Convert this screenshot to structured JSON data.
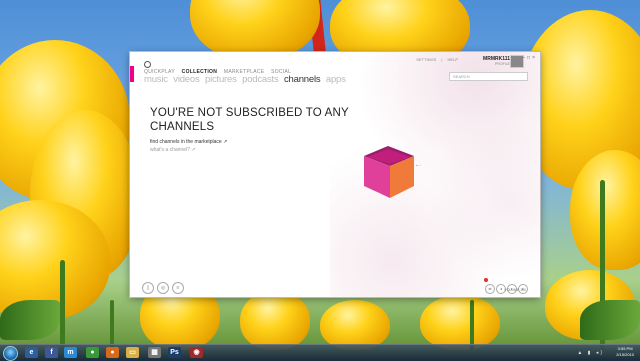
{
  "window": {
    "nav_primary": [
      "QUICKPLAY",
      "COLLECTION",
      "MARKETPLACE",
      "SOCIAL"
    ],
    "nav_primary_active": "COLLECTION",
    "nav_secondary": [
      "music",
      "videos",
      "pictures",
      "podcasts",
      "channels",
      "apps"
    ],
    "nav_secondary_active": "channels",
    "top_links": [
      "SETTINGS",
      "HELP"
    ],
    "user_name": "MRMRK111",
    "user_sub": "PROFILE",
    "search_placeholder": "SEARCH",
    "headline": "YOU'RE NOT SUBSCRIBED TO ANY CHANNELS",
    "link_find": "find channels in the marketplace",
    "link_what": "what's a channel?",
    "volume_label": "VOLUME 100"
  },
  "colors": {
    "accent": "#ec008c",
    "cube_top": "#d0248a",
    "cube_front": "#f07a3a"
  },
  "taskbar": {
    "clock_time": "3:55 PM",
    "clock_date": "2/15/2010",
    "icons": [
      "start-orb-icon",
      "explorer-icon",
      "facebook-icon",
      "messenger-icon",
      "chrome-icon",
      "firefox-icon",
      "folder-icon",
      "calculator-icon",
      "photoshop-icon",
      "media-icon"
    ]
  }
}
